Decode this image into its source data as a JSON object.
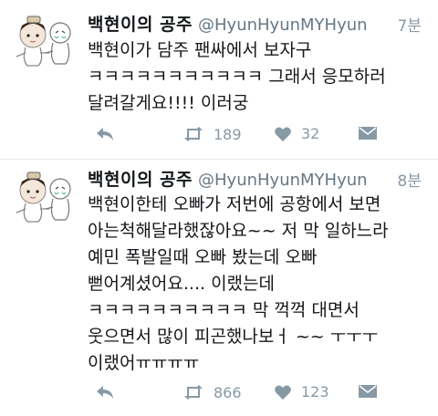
{
  "tweets": [
    {
      "name": "백현이의 공주",
      "handle": "@HyunHyunMYHyun",
      "time": "7분",
      "text": "백현이가 담주 팬싸에서 보자구\nㅋㅋㅋㅋㅋㅋㅋㅋㅋㅋㅋ 그래서 응모하러\n달려갈게요!!!! 이러궁",
      "retweets": "189",
      "likes": "32"
    },
    {
      "name": "백현이의 공주",
      "handle": "@HyunHyunMYHyun",
      "time": "8분",
      "text": "백현이한테 오빠가 저번에 공항에서 보면\n아는척해달라했잖아요~~ 저 막 일하느라\n예민 폭발일때 오빠 봤는데 오빠\n뻗어계셨어요.... 이랬는데\nㅋㅋㅋㅋㅋㅋㅋㅋㅋㅋ 막 꺽꺽 대면서\n웃으면서 많이 피곤했나보ㅓ ~~ ㅜㅜㅜ\n이랬어ㅠㅠㅠㅠ",
      "retweets": "866",
      "likes": "123"
    }
  ],
  "icons": {
    "reply": "reply-icon",
    "retweet": "retweet-icon",
    "like": "heart-icon",
    "dm": "envelope-icon"
  },
  "colors": {
    "text": "#14171a",
    "muted": "#8899a6",
    "divider": "#e1e8ed"
  }
}
